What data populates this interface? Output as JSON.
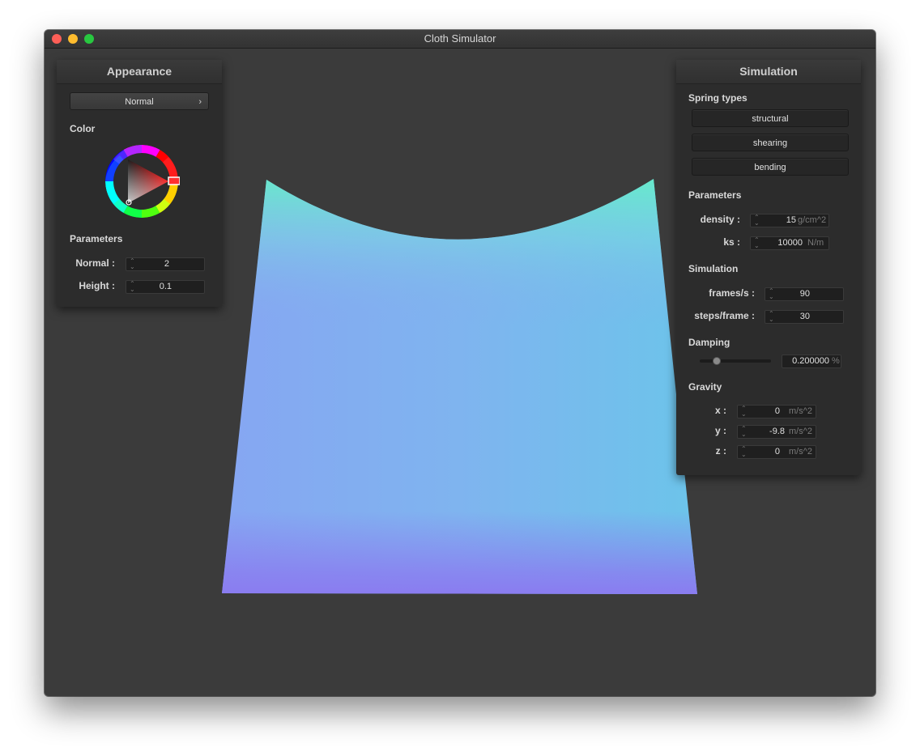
{
  "window": {
    "title": "Cloth Simulator"
  },
  "appearance": {
    "header": "Appearance",
    "shader": "Normal",
    "color_label": "Color",
    "selected_color": "#ff0000",
    "parameters_label": "Parameters",
    "params": [
      {
        "label": "Normal :",
        "value": "2"
      },
      {
        "label": "Height :",
        "value": "0.1"
      }
    ]
  },
  "simulation": {
    "header": "Simulation",
    "spring_types_label": "Spring types",
    "spring_types": [
      "structural",
      "shearing",
      "bending"
    ],
    "parameters_label": "Parameters",
    "density": {
      "label": "density :",
      "value": "15",
      "unit": "g/cm^2"
    },
    "ks": {
      "label": "ks :",
      "value": "10000",
      "unit": "N/m"
    },
    "simulation_label": "Simulation",
    "frames": {
      "label": "frames/s :",
      "value": "90"
    },
    "steps": {
      "label": "steps/frame :",
      "value": "30"
    },
    "damping_label": "Damping",
    "damping": {
      "value": "0.200000",
      "unit": "%",
      "slider_fraction": 0.2
    },
    "gravity_label": "Gravity",
    "gravity": [
      {
        "label": "x :",
        "value": "0",
        "unit": "m/s^2"
      },
      {
        "label": "y :",
        "value": "-9.8",
        "unit": "m/s^2"
      },
      {
        "label": "z :",
        "value": "0",
        "unit": "m/s^2"
      }
    ]
  },
  "colors": {
    "window_bg": "#3b3b3b",
    "panel_bg": "#2c2c2c",
    "cloth_base": "#7fb0f0",
    "cloth_highlight": "#6ee8c8",
    "cloth_edge": "#8a7cf0"
  }
}
